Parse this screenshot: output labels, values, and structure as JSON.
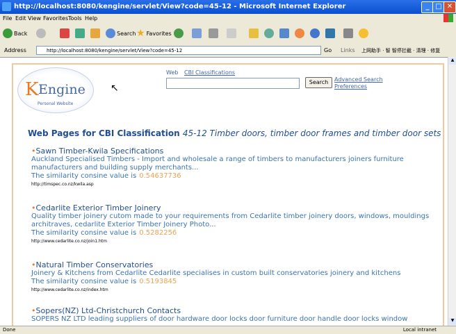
{
  "window": {
    "title": "http://localhost:8080/kengine/servlet/View?code=45-12 - Microsoft Internet Explorer"
  },
  "menu": [
    "File",
    "Edit",
    "View",
    "Favorites",
    "Tools",
    "Help"
  ],
  "toolbar": {
    "back": "Back",
    "search": "Search",
    "favorites": "Favorites"
  },
  "address": {
    "label": "Address",
    "url": "http://localhost:8080/kengine/servlet/View?code=45-12",
    "go": "Go",
    "links": "Links",
    "extras": "上网助手 · 智 智停拦截 · 清理 · 修复"
  },
  "logo": {
    "k": "K",
    "engine": "Engine",
    "sub": "Personal Website"
  },
  "search": {
    "tab_web": "Web",
    "tab_cbi": "CBI Classifications",
    "button": "Search",
    "advanced": "Advanced Search",
    "preferences": "Preferences"
  },
  "heading": {
    "prefix": "Web Pages for CBI Classification",
    "classification": "45-12 Timber doors, timber door frames and timber door sets"
  },
  "sim_label": "The similarity consine value is",
  "results": [
    {
      "title": "Sawn Timber-Kwila Specifications",
      "desc": "Auckland Specialised Timbers - Import and wholesale a range of timbers to manufacturers joiners furniture manufacturers and building supply merchants...",
      "sim": "0.54637736",
      "url": "http://timspec.co.nz/kwila.asp"
    },
    {
      "title": "Cedarlite Exterior Timber Joinery",
      "desc": "Quality timber joinery cutom made to your requirements from Cedarlite timber joinery doors, windows, mouldings architraves, cedarlite Exterior Timber Joinery Photo...",
      "sim": "0.5282256",
      "url": "http://www.cedarlite.co.nz/join1.htm"
    },
    {
      "title": "Natural Timber Conservatories",
      "desc": "Joinery & Kitchens from Cedarlite Cedarlite specialises in custom built conservatories joinery and kitchens",
      "sim": "0.5193845",
      "url": "http://www.cedarlite.co.nz/index.htm"
    },
    {
      "title": "Sopers(NZ) Ltd-Christchurch Contacts",
      "desc": "SOPERS NZ LTD leading suppliers of door hardware door locks door furniture door handle door locks window",
      "sim": "",
      "url": ""
    }
  ],
  "status": {
    "left": "Done",
    "right": "Local intranet"
  },
  "colors": {
    "title_blue": "#1f4e96",
    "text_blue": "#3b73b4",
    "accent_orange": "#e47b29",
    "score_orange": "#f0a050",
    "frame_border": "#f5c79d"
  }
}
